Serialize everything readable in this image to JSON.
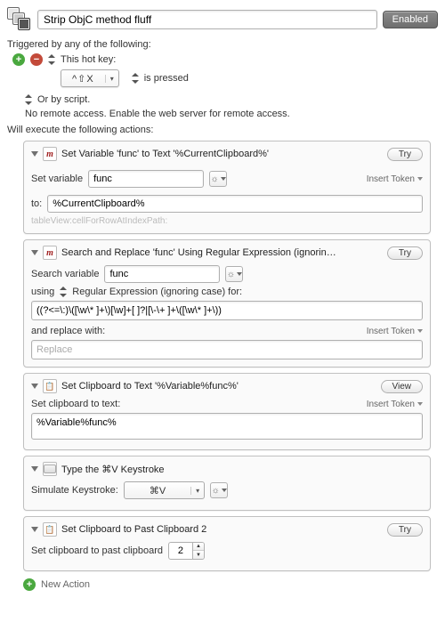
{
  "header": {
    "title": "Strip ObjC method fluff",
    "enabled_label": "Enabled"
  },
  "triggers": {
    "heading": "Triggered by any of the following:",
    "hotkey_label": "This hot key:",
    "hotkey_value": "^⇧X",
    "is_pressed": "is pressed",
    "script_label": "Or by script.",
    "remote": "No remote access.  Enable the web server for remote access."
  },
  "actions_heading": "Will execute the following actions:",
  "insert_token": "Insert Token",
  "try_label": "Try",
  "view_label": "View",
  "action1": {
    "title": "Set Variable 'func' to Text '%CurrentClipboard%'",
    "set_variable_label": "Set variable",
    "variable_name": "func",
    "to_label": "to:",
    "to_value": "%CurrentClipboard%",
    "preview": "tableView:cellForRowAtIndexPath:"
  },
  "action2": {
    "title": "Search and Replace 'func' Using Regular Expression (ignorin…",
    "search_variable_label": "Search variable",
    "variable_name": "func",
    "using_label": "using",
    "regex_mode": "Regular Expression (ignoring case) for:",
    "regex_value": "((?<=\\:)\\([\\w\\* ]+\\)[\\w]+[ ]?|[\\-\\+ ]+\\([\\w\\* ]+\\))",
    "replace_label": "and replace with:",
    "replace_placeholder": "Replace"
  },
  "action3": {
    "title": "Set Clipboard to Text '%Variable%func%'",
    "set_label": "Set clipboard to text:",
    "value": "%Variable%func%"
  },
  "action4": {
    "title": "Type the ⌘V Keystroke",
    "simulate_label": "Simulate Keystroke:",
    "keystroke": "⌘V"
  },
  "action5": {
    "title": "Set Clipboard to Past Clipboard 2",
    "label": "Set clipboard to past clipboard",
    "value": "2"
  },
  "new_action": "New Action"
}
